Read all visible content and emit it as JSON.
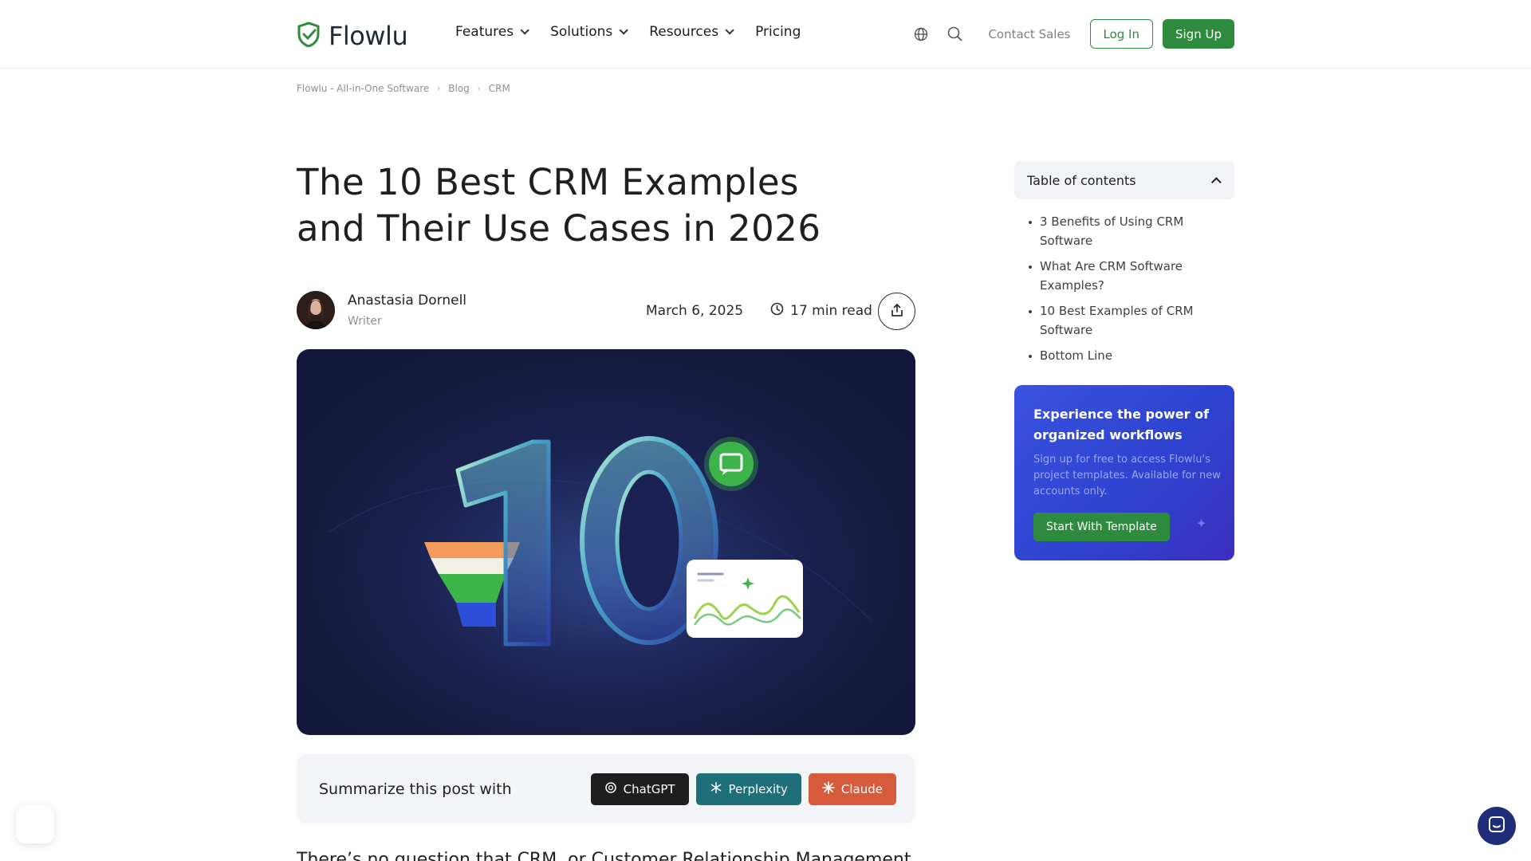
{
  "header": {
    "logo_text": "Flowlu",
    "nav": [
      {
        "label": "Features",
        "has_dropdown": true
      },
      {
        "label": "Solutions",
        "has_dropdown": true
      },
      {
        "label": "Resources",
        "has_dropdown": true
      },
      {
        "label": "Pricing",
        "has_dropdown": false
      }
    ],
    "contact_sales": "Contact Sales",
    "login": "Log In",
    "signup": "Sign Up",
    "icons": [
      "globe-icon",
      "search-icon"
    ]
  },
  "breadcrumb": [
    "Flowlu - All-in-One Software",
    "Blog",
    "CRM"
  ],
  "article": {
    "title": "The 10 Best CRM Examples and Their Use Cases in 2026",
    "author_name": "Anastasia Dornell",
    "author_role": "Writer",
    "date": "March 6, 2025",
    "read_time": "17 min read",
    "hero_number": "10",
    "summarize_label": "Summarize this post with",
    "summarize_buttons": [
      {
        "label": "ChatGPT",
        "color": "#1e1e1e"
      },
      {
        "label": "Perplexity",
        "color": "#1f6f7a"
      },
      {
        "label": "Claude",
        "color": "#d65a3c"
      }
    ],
    "body_start": "There’s no question that CRM, or Customer Relationship Management"
  },
  "sidebar": {
    "toc_title": "Table of contents",
    "toc_items": [
      "3 Benefits of Using CRM Software",
      "What Are CRM Software Examples?",
      "10 Best Examples of CRM Software",
      "Bottom Line"
    ],
    "promo": {
      "title": "Experience the power of organized workflows",
      "text": "Sign up for free to access Flowlu's project templates. Available for new accounts only.",
      "button": "Start With Template"
    }
  },
  "colors": {
    "brand_green": "#2e8b3e",
    "promo_blue": "#3a52e0",
    "hero_bg": "#151a3e"
  }
}
